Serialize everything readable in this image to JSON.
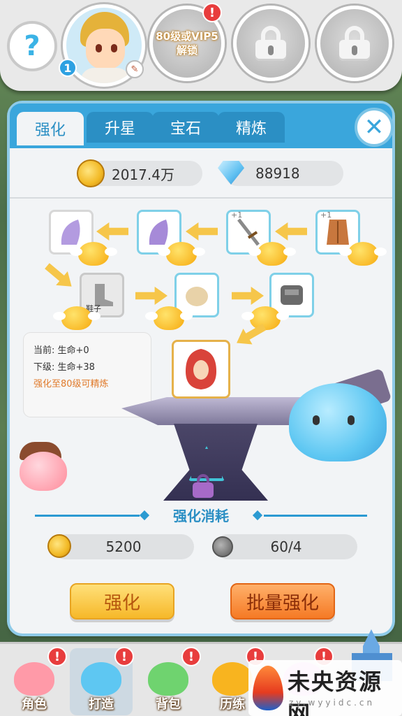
{
  "header": {
    "help_label": "?",
    "player_level": "1",
    "unlock_slot_text": "80级或VIP5\n解锁",
    "unlock_alert": "!"
  },
  "panel": {
    "tabs": [
      {
        "label": "强化",
        "active": true
      },
      {
        "label": "升星",
        "active": false
      },
      {
        "label": "宝石",
        "active": false
      },
      {
        "label": "精炼",
        "active": false
      }
    ],
    "close_label": "✕",
    "gold_amount": "2017.4万",
    "diamond_amount": "88918",
    "items": {
      "boots_label": "鞋子",
      "plus1": "+1"
    },
    "info": {
      "current": "当前: 生命+0",
      "next": "下级: 生命+38",
      "hint": "强化至80级可精炼"
    },
    "cost": {
      "title": "强化消耗",
      "gold": "5200",
      "stone": "60/4"
    },
    "buttons": {
      "enhance": "强化",
      "batch_enhance": "批量强化"
    }
  },
  "bottom_nav": {
    "items": [
      {
        "label": "角色",
        "alert": "!",
        "color": "#ff9aa8"
      },
      {
        "label": "打造",
        "alert": "!",
        "color": "#5ec7f2"
      },
      {
        "label": "背包",
        "alert": "!",
        "color": "#6fd36f"
      },
      {
        "label": "历练",
        "alert": "!",
        "color": "#f8b41f"
      },
      {
        "label": "",
        "alert": "!",
        "color": "#e8a0f0"
      }
    ]
  },
  "watermark": {
    "title": "未央资源网",
    "url": "zy.wyyidc.cn"
  },
  "colors": {
    "accent_blue": "#3aa6dc",
    "alert_red": "#e83d3d",
    "button_yellow": "#f6b829",
    "button_orange": "#f57a25"
  }
}
